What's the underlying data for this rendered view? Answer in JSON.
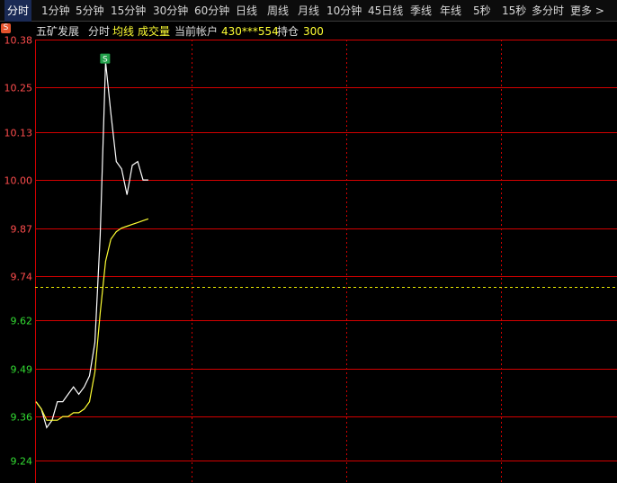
{
  "toolbar": {
    "tabs": [
      {
        "label": "分时",
        "active": true
      },
      {
        "label": "1分钟"
      },
      {
        "label": "5分钟"
      },
      {
        "label": "15分钟"
      },
      {
        "label": "30分钟"
      },
      {
        "label": "60分钟"
      },
      {
        "label": "日线"
      },
      {
        "label": "周线"
      },
      {
        "label": "月线"
      },
      {
        "label": "10分钟"
      },
      {
        "label": "45日线"
      },
      {
        "label": "季线"
      },
      {
        "label": "年线"
      },
      {
        "label": "5秒"
      },
      {
        "label": "15秒"
      },
      {
        "label": "多分时"
      },
      {
        "label": "更多 >"
      }
    ]
  },
  "info_bar": {
    "badge": "S",
    "stock_name": "五矿发展",
    "mode": "分时",
    "avg_line": "均线",
    "volume": "成交量",
    "account_label": "当前帐户",
    "account_value": "430***554",
    "position_label": "持仓",
    "position_value": "300"
  },
  "colors": {
    "grid": "#d40000",
    "price_line": "#ffffff",
    "avg_line": "#ffff33",
    "ref_line": "#e8e800",
    "axis_up": "#ff4d4d",
    "axis_down": "#33dd33",
    "marker_bg": "#22a04a"
  },
  "chart_data": {
    "type": "line",
    "y_axis": {
      "ylim": [
        9.18,
        10.38
      ],
      "ticks": [
        10.38,
        10.25,
        10.13,
        10.0,
        9.87,
        9.74,
        9.62,
        9.49,
        9.36,
        9.24
      ],
      "prev_close": 9.71
    },
    "marker": {
      "label": "S",
      "index": 13
    },
    "series": [
      {
        "key": "price",
        "values": [
          9.4,
          9.38,
          9.33,
          9.35,
          9.4,
          9.4,
          9.42,
          9.44,
          9.42,
          9.44,
          9.47,
          9.56,
          9.85,
          10.32,
          10.18,
          10.05,
          10.03,
          9.96,
          10.04,
          10.05,
          10.0,
          10.0
        ]
      },
      {
        "key": "avg",
        "values": [
          9.4,
          9.38,
          9.35,
          9.35,
          9.35,
          9.36,
          9.36,
          9.37,
          9.37,
          9.38,
          9.4,
          9.48,
          9.64,
          9.78,
          9.84,
          9.86,
          9.87,
          9.875,
          9.88,
          9.885,
          9.89,
          9.895
        ]
      }
    ]
  }
}
